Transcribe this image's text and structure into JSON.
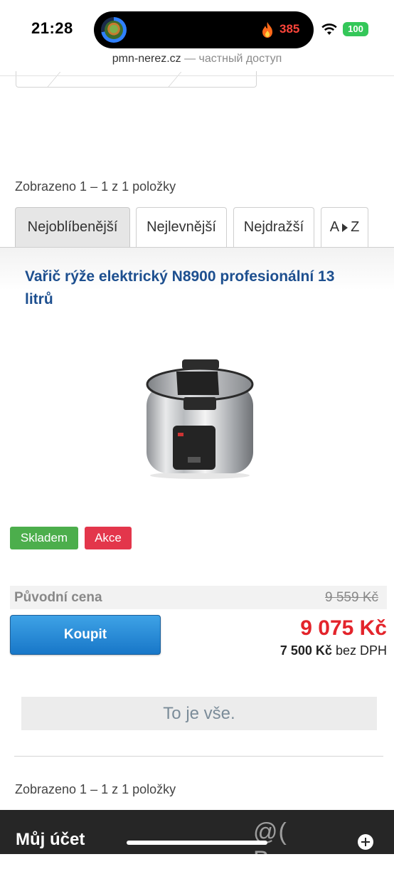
{
  "status_bar": {
    "time": "21:28",
    "activity_count": "385",
    "battery": "100"
  },
  "browser": {
    "domain": "pmn-nerez.cz",
    "subtitle": "— частный доступ"
  },
  "listing": {
    "count_top": "Zobrazeno 1 – 1 z 1 položky",
    "count_bottom": "Zobrazeno 1 – 1 z 1 položky",
    "sort_tabs": [
      {
        "label": "Nejoblíbenější",
        "active": true
      },
      {
        "label": "Nejlevnější",
        "active": false
      },
      {
        "label": "Nejdražší",
        "active": false
      },
      {
        "label_a": "A",
        "label_z": "Z",
        "active": false
      }
    ]
  },
  "product": {
    "title": "Vařič rýže elektrický N8900 profesionální 13 litrů",
    "badges": {
      "stock": "Skladem",
      "sale": "Akce"
    },
    "original_price_label": "Původní cena",
    "original_price": "9 559 Kč",
    "price": "9 075 Kč",
    "price_net": "7 500 Kč",
    "price_net_suffix": "bez DPH",
    "buy_label": "Koupit"
  },
  "end_message": "To je vše.",
  "footer": {
    "title": "Můj účet",
    "watermark": "@( Bazos.cz"
  },
  "colors": {
    "title_blue": "#1d4f8f",
    "price_red": "#e3242b",
    "stock_green": "#4cae4c",
    "sale_red": "#e3364b",
    "button_blue": "#1877c8"
  }
}
